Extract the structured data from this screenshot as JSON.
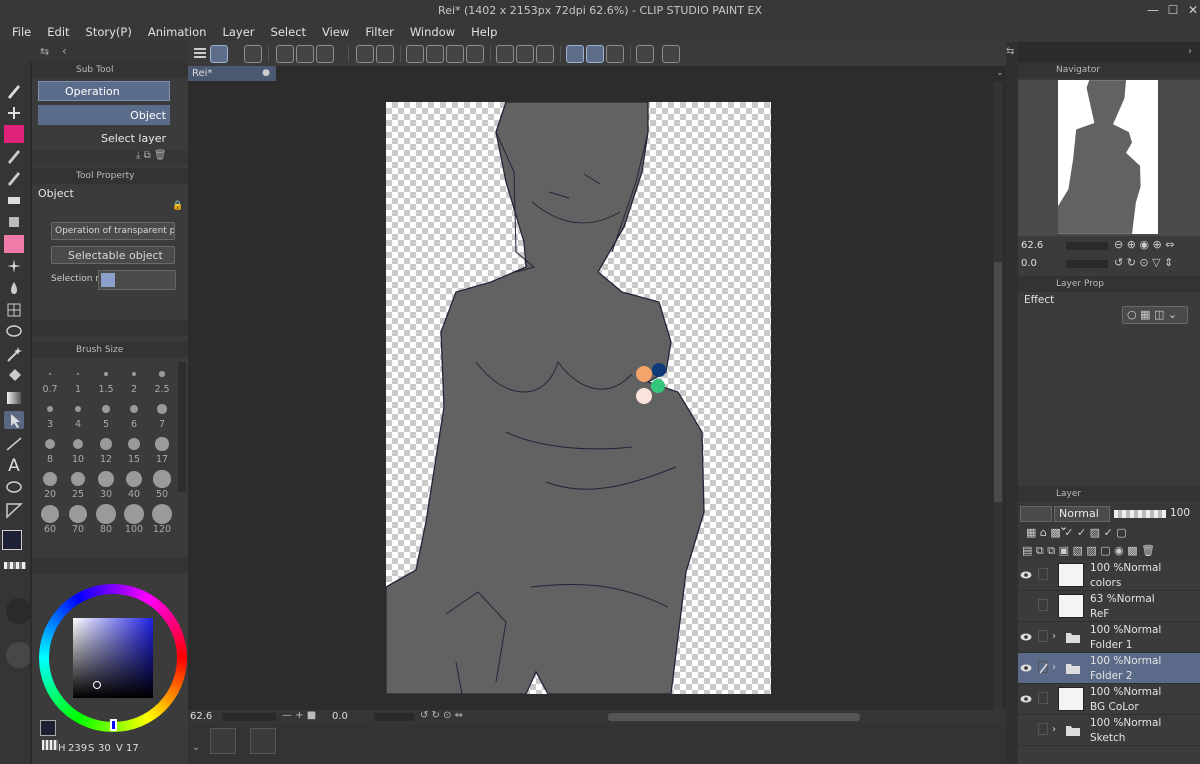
{
  "window": {
    "title": "Rei* (1402 x 2153px 72dpi 62.6%) - CLIP STUDIO PAINT EX",
    "controls": [
      "—",
      "☐",
      "✕"
    ]
  },
  "menu": [
    "File",
    "Edit",
    "Story(P)",
    "Animation",
    "Layer",
    "Select",
    "View",
    "Filter",
    "Window",
    "Help"
  ],
  "canvas_tab": {
    "label": "Rei*"
  },
  "subtool_panel": {
    "header": "Sub Tool",
    "group": "Operation",
    "items": [
      "Object",
      "Select layer"
    ]
  },
  "tool_property": {
    "header": "Tool Property",
    "title": "Object",
    "dropdown1": "Operation of transparent part",
    "dropdown2": "Selectable object",
    "selection_label": "Selection mo"
  },
  "brush_size": {
    "header": "Brush Size",
    "sizes": [
      "0.7",
      "1",
      "1.5",
      "2",
      "2.5",
      "3",
      "4",
      "5",
      "6",
      "7",
      "8",
      "10",
      "12",
      "15",
      "17",
      "20",
      "25",
      "30",
      "40",
      "50",
      "60",
      "70",
      "80",
      "100",
      "120"
    ]
  },
  "color_status": {
    "h": "239",
    "s": "30",
    "v": "17"
  },
  "canvas_status": {
    "zoom": "62.6",
    "angle": "0.0"
  },
  "navigator": {
    "header": "Navigator",
    "zoom": "62.6",
    "angle": "0.0"
  },
  "layer_property": {
    "header": "Layer Prop",
    "effect_label": "Effect"
  },
  "layer_panel": {
    "header": "Layer",
    "blend_mode": "Normal",
    "opacity": "100",
    "layers": [
      {
        "l1": "100 %Normal",
        "l2": "colors",
        "type": "raster",
        "visible": true,
        "selected": false
      },
      {
        "l1": "63 %Normal",
        "l2": "ReF",
        "type": "raster",
        "visible": false,
        "selected": false
      },
      {
        "l1": "100 %Normal",
        "l2": "Folder 1",
        "type": "folder",
        "visible": true,
        "selected": false
      },
      {
        "l1": "100 %Normal",
        "l2": "Folder 2",
        "type": "folder",
        "visible": true,
        "selected": true
      },
      {
        "l1": "100 %Normal",
        "l2": "BG CoLor",
        "type": "raster",
        "visible": true,
        "selected": false
      },
      {
        "l1": "100 %Normal",
        "l2": "Sketch",
        "type": "folder",
        "visible": false,
        "selected": false
      }
    ]
  },
  "colors": {
    "main_color": "#1e2033",
    "sub_color": "#ffffff",
    "palette": [
      "#f4a46a",
      "#0f3a7a",
      "#34c77b",
      "#fbe3dc"
    ],
    "selection_accent": "#5a6a88"
  }
}
